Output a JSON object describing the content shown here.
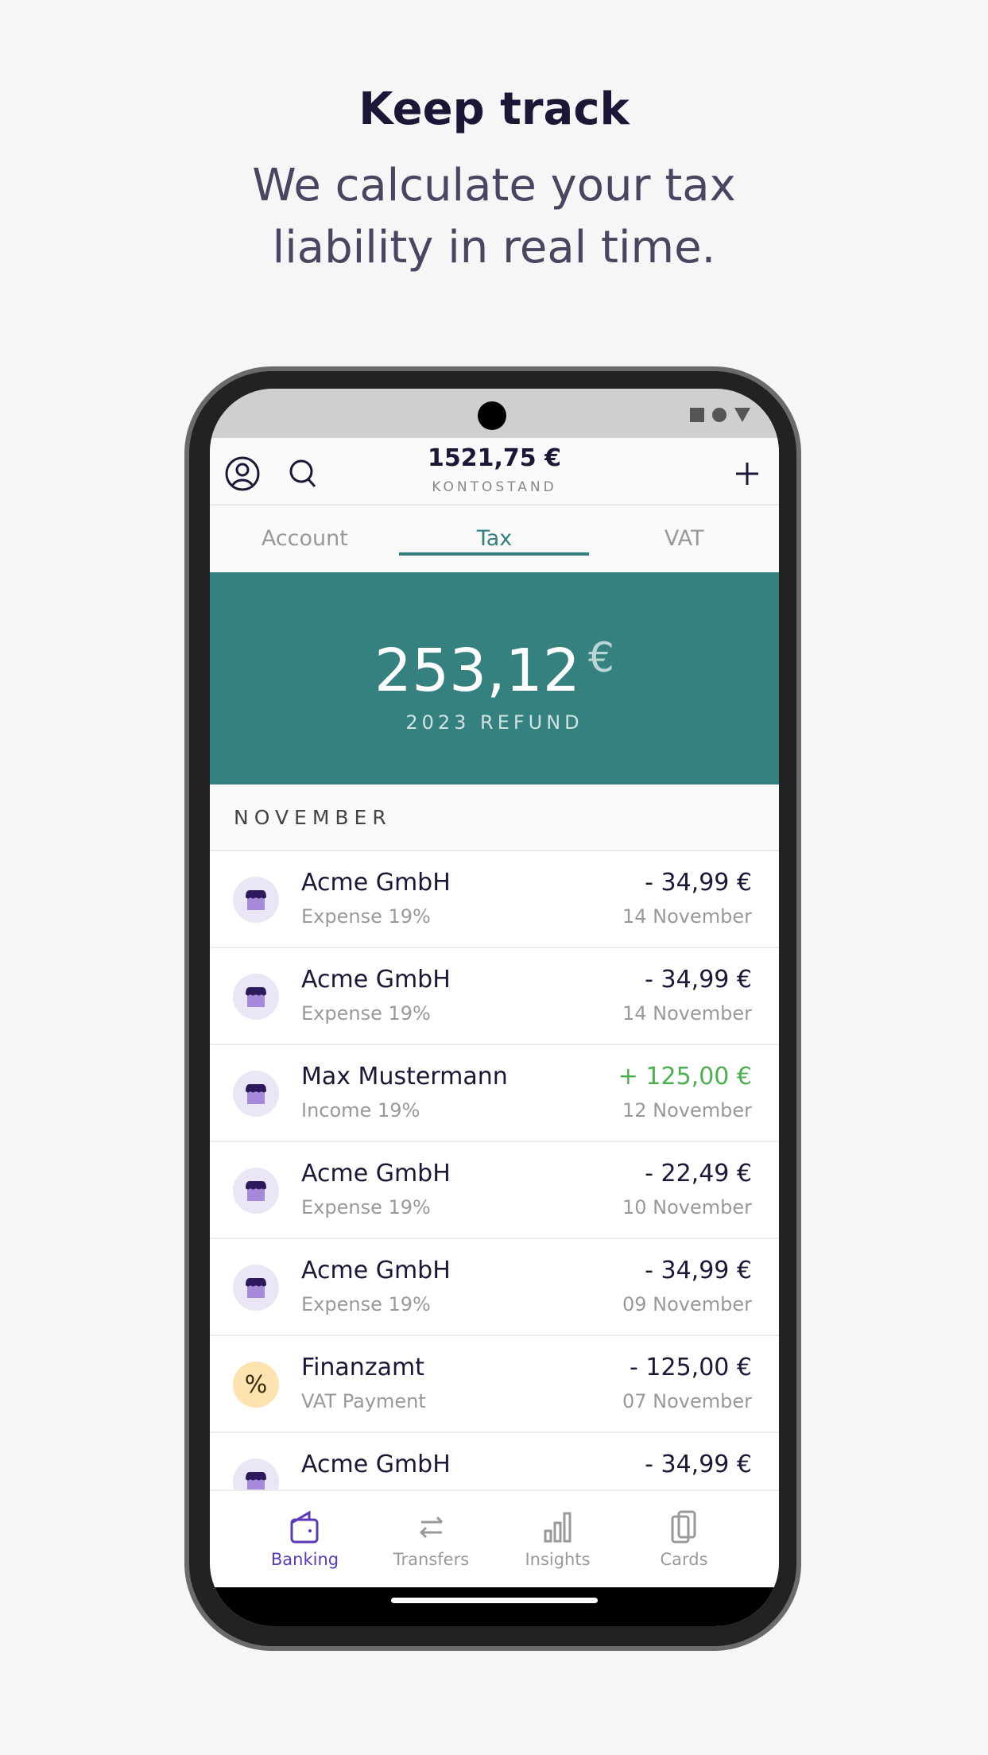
{
  "marketing": {
    "title": "Keep track",
    "subtitle_line1": "We calculate your tax",
    "subtitle_line2": "liability in real time."
  },
  "header": {
    "balance": "1521,75 €",
    "balance_label": "KONTOSTAND",
    "icons": [
      "profile-icon",
      "search-icon",
      "plus-icon"
    ]
  },
  "tabs": [
    {
      "label": "Account",
      "active": false
    },
    {
      "label": "Tax",
      "active": true
    },
    {
      "label": "VAT",
      "active": false
    }
  ],
  "hero": {
    "amount": "253,12",
    "currency": "€",
    "label": "2023 REFUND"
  },
  "section": "NOVEMBER",
  "transactions": [
    {
      "name": "Acme GmbH",
      "category": "Expense 19%",
      "amount": "- 34,99 €",
      "date": "14 November",
      "icon": "store-icon",
      "positive": false
    },
    {
      "name": "Acme GmbH",
      "category": "Expense 19%",
      "amount": "- 34,99 €",
      "date": "14 November",
      "icon": "store-icon",
      "positive": false
    },
    {
      "name": "Max Mustermann",
      "category": "Income 19%",
      "amount": "+ 125,00 €",
      "date": "12 November",
      "icon": "store-icon",
      "positive": true
    },
    {
      "name": "Acme GmbH",
      "category": "Expense 19%",
      "amount": "- 22,49 €",
      "date": "10 November",
      "icon": "store-icon",
      "positive": false
    },
    {
      "name": "Acme GmbH",
      "category": "Expense 19%",
      "amount": "- 34,99 €",
      "date": "09 November",
      "icon": "store-icon",
      "positive": false
    },
    {
      "name": "Finanzamt",
      "category": "VAT Payment",
      "amount": "- 125,00 €",
      "date": "07 November",
      "icon": "percent-icon",
      "positive": false
    },
    {
      "name": "Acme GmbH",
      "category": "",
      "amount": "- 34,99 €",
      "date": "",
      "icon": "store-icon",
      "positive": false
    }
  ],
  "nav": [
    {
      "label": "Banking",
      "icon": "wallet-icon",
      "active": true
    },
    {
      "label": "Transfers",
      "icon": "transfer-icon",
      "active": false
    },
    {
      "label": "Insights",
      "icon": "bar-chart-icon",
      "active": false
    },
    {
      "label": "Cards",
      "icon": "cards-icon",
      "active": false
    }
  ],
  "colors": {
    "teal": "#35817f",
    "accent": "#5b3ab8",
    "positive": "#4caf50",
    "text": "#1e1636"
  }
}
